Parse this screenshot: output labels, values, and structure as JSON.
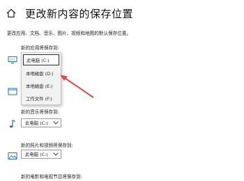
{
  "header": {
    "title": "更改新内容的保存位置",
    "home_icon": "home-icon"
  },
  "description": "更改应用、文档、音乐、图片、视频和地图的默认保存位置。",
  "sections": {
    "apps": {
      "label": "新的应用将保存到:",
      "icon": "monitor-icon"
    },
    "docs": {
      "icon": "folder-icon"
    },
    "music": {
      "label": "新的音乐将保存到:",
      "icon": "music-note-icon",
      "value": "此电脑 (C:)"
    },
    "photos": {
      "label": "新的照片和视频将保存到:",
      "icon": "picture-icon",
      "value": "此电脑 (C:)"
    },
    "movies": {
      "label": "新的电影和电视节目将保存到:"
    }
  },
  "dropdown": {
    "options": [
      "此电脑 (C:)",
      "本地磁盘 (D:)",
      "本地磁盘 (E:)",
      "工作文件 (F:)"
    ],
    "selected_index": 0
  },
  "colors": {
    "arrow": "#e5483f",
    "accent": "#1a73c8"
  }
}
